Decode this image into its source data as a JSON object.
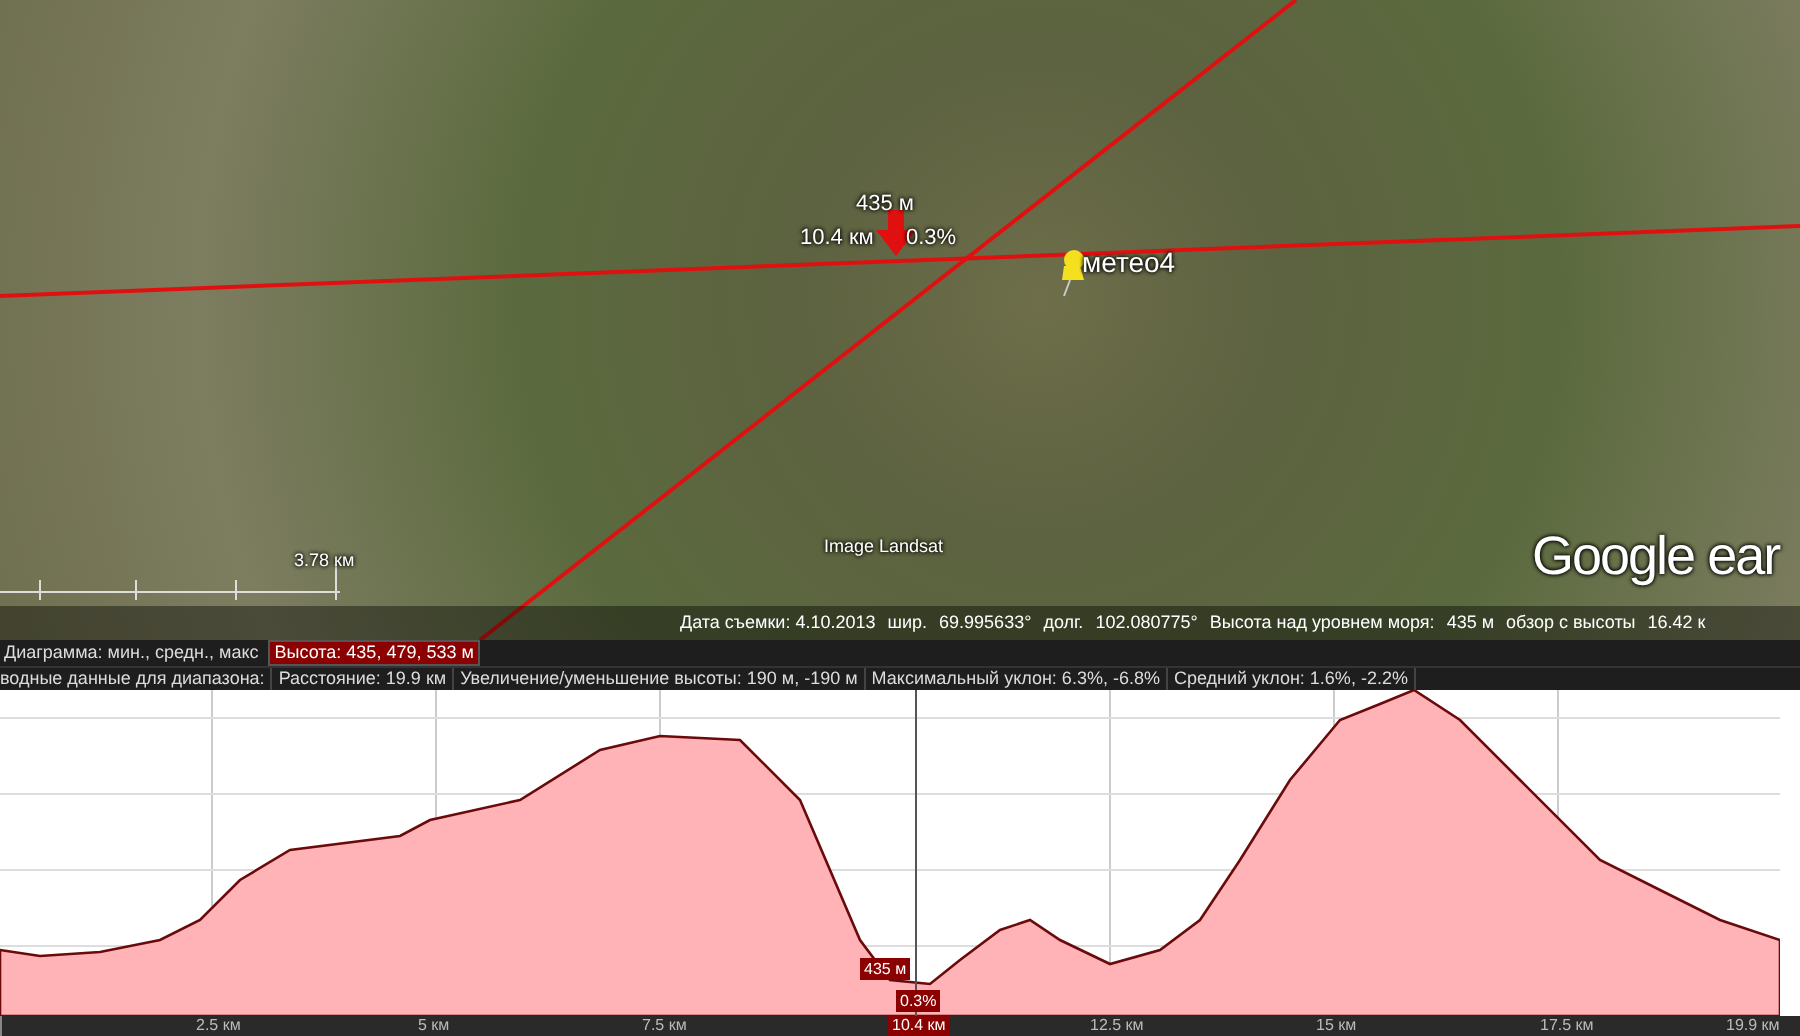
{
  "map": {
    "marker": {
      "elevation": "435 м",
      "distance": "10.4 км",
      "slope": "0.3%"
    },
    "placemark": {
      "label": "метео4"
    },
    "scale": {
      "label": "3.78 км"
    },
    "imagery_credit": "Image Landsat",
    "logo": "Google ear"
  },
  "status_bar": [
    {
      "kind": "text",
      "text": "Дата съемки: 4.10.2013"
    },
    {
      "kind": "text",
      "text": "шир."
    },
    {
      "kind": "text",
      "text": "69.995633°"
    },
    {
      "kind": "text",
      "text": "долг."
    },
    {
      "kind": "text",
      "text": "102.080775°"
    },
    {
      "kind": "text",
      "text": "Высота над уровнем моря:"
    },
    {
      "kind": "text",
      "text": "435 м"
    },
    {
      "kind": "text",
      "text": "обзор с высоты"
    },
    {
      "kind": "text",
      "text": "16.42 к"
    }
  ],
  "profile": {
    "header_row_1": [
      {
        "text": "Диаграмма: мин., средн., макс",
        "selected": false
      },
      {
        "text": "Высота: 435, 479, 533 м",
        "selected": true
      }
    ],
    "header_row_2": [
      "водные данные для диапазона:",
      "Расстояние: 19.9 км",
      "Увеличение/уменьшение высоты: 190 м, -190 м",
      "Максимальный уклон: 6.3%, -6.8%",
      "Средний уклон: 1.6%, -2.2%"
    ],
    "cursor": {
      "elevation": "435 м",
      "slope": "0.3%",
      "distance": "10.4 км"
    },
    "x_labels": [
      "2.5 км",
      "5 км",
      "7.5 км",
      "12.5 км",
      "15 км",
      "17.5 км",
      "19.9 км"
    ]
  }
}
